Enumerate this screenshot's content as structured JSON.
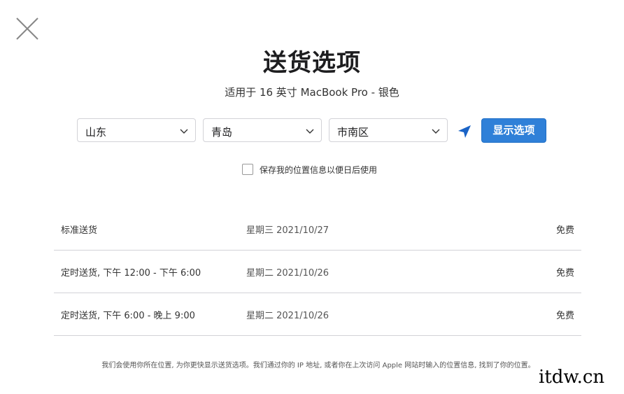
{
  "modal": {
    "title": "送货选项",
    "subtitle": "适用于 16 英寸 MacBook Pro - 银色"
  },
  "location": {
    "province": "山东",
    "city": "青岛",
    "district": "市南区",
    "show_button": "显示选项",
    "save_label": "保存我的位置信息以便日后使用",
    "save_checked": false
  },
  "delivery_options": [
    {
      "name": "标准送货",
      "date": "星期三 2021/10/27",
      "price": "免费"
    },
    {
      "name": "定时送货, 下午 12:00 - 下午 6:00",
      "date": "星期二 2021/10/26",
      "price": "免费"
    },
    {
      "name": "定时送货, 下午 6:00 - 晚上 9:00",
      "date": "星期二 2021/10/26",
      "price": "免费"
    }
  ],
  "footnote": "我们会使用你所在位置, 为你更快显示送货选项。我们通过你的 IP 地址, 或者你在上次访问 Apple 网站时输入的位置信息, 找到了你的位置。",
  "watermark": "itdw.cn",
  "colors": {
    "accent": "#2f80d8",
    "location_icon": "#1a63c6",
    "divider": "#d2d2d7"
  },
  "icons": {
    "close": "close-icon",
    "chevron": "chevron-down-icon",
    "locate": "location-arrow-icon"
  }
}
